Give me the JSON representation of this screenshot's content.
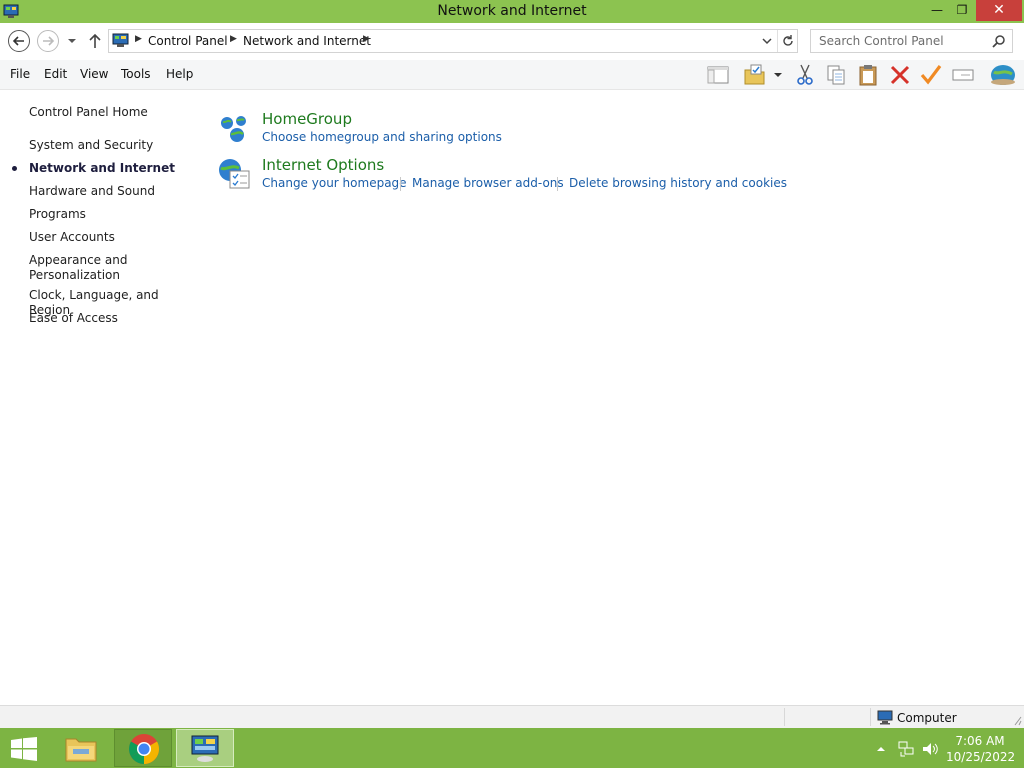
{
  "window": {
    "title": "Network and Internet",
    "minimize_glyph": "—",
    "maximize_glyph": "❐",
    "close_glyph": "✕"
  },
  "address": {
    "crumbs": [
      "Control Panel",
      "Network and Internet"
    ],
    "search_placeholder": "Search Control Panel"
  },
  "menu": {
    "file": "File",
    "edit": "Edit",
    "view": "View",
    "tools": "Tools",
    "help": "Help"
  },
  "toolbar_icons": [
    "layout-icon",
    "folder-options-icon",
    "cut-icon",
    "copy-icon",
    "paste-icon",
    "delete-icon",
    "properties-check-icon",
    "rename-icon",
    "network-globe-icon"
  ],
  "sidebar": {
    "home": "Control Panel Home",
    "items": [
      "System and Security",
      "Network and Internet",
      "Hardware and Sound",
      "Programs",
      "User Accounts",
      "Appearance and",
      "Personalization",
      "Clock, Language, and Region",
      "Ease of Access"
    ],
    "active_index": 1
  },
  "categories": {
    "homegroup": {
      "title": "HomeGroup",
      "links": [
        "Choose homegroup and sharing options"
      ]
    },
    "internet_options": {
      "title": "Internet Options",
      "links": [
        "Change your homepage",
        "Manage browser add-ons",
        "Delete browsing history and cookies"
      ]
    }
  },
  "status": {
    "location": "Computer"
  },
  "taskbar": {
    "apps": [
      "windows-start",
      "file-explorer",
      "google-chrome",
      "control-panel"
    ],
    "time": "7:06 AM",
    "date": "10/25/2022"
  },
  "colors": {
    "titlebar": "#8cc350",
    "taskbar": "#7db443",
    "link": "#1b5ea9",
    "category_title": "#1e7a1e",
    "close_button": "#c8403b"
  }
}
